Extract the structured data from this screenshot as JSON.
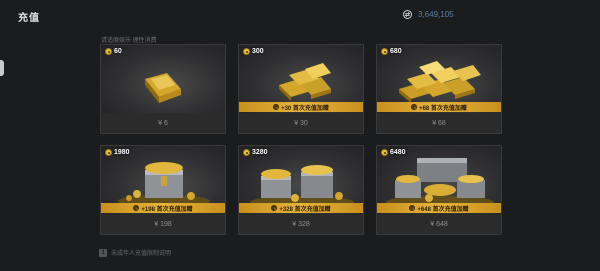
{
  "header": {
    "title": "充值",
    "balance": "3,649,105",
    "subtitle": "请适度娱乐 理性消费"
  },
  "packs": [
    {
      "amount": "60",
      "price": "¥ 6",
      "bonus": ""
    },
    {
      "amount": "300",
      "price": "¥ 30",
      "bonus": "+30 首次充值加赠"
    },
    {
      "amount": "680",
      "price": "¥ 68",
      "bonus": "+68 首次充值加赠"
    },
    {
      "amount": "1980",
      "price": "¥ 198",
      "bonus": "+198 首次充值加赠"
    },
    {
      "amount": "3280",
      "price": "¥ 328",
      "bonus": "+328 首次充值加赠"
    },
    {
      "amount": "6480",
      "price": "¥ 648",
      "bonus": "+648 首次充值加赠"
    }
  ],
  "footer": {
    "info_icon": "1",
    "text": "未成年人充值限制说明"
  },
  "colors": {
    "background": "#1b1c1e",
    "bonus_strip": "#e6b43a",
    "balance_text": "#5c7fa7"
  },
  "icons": {
    "balance": "coin-icon",
    "pack_currency": "gold-coin-icon",
    "footer": "info-icon"
  }
}
